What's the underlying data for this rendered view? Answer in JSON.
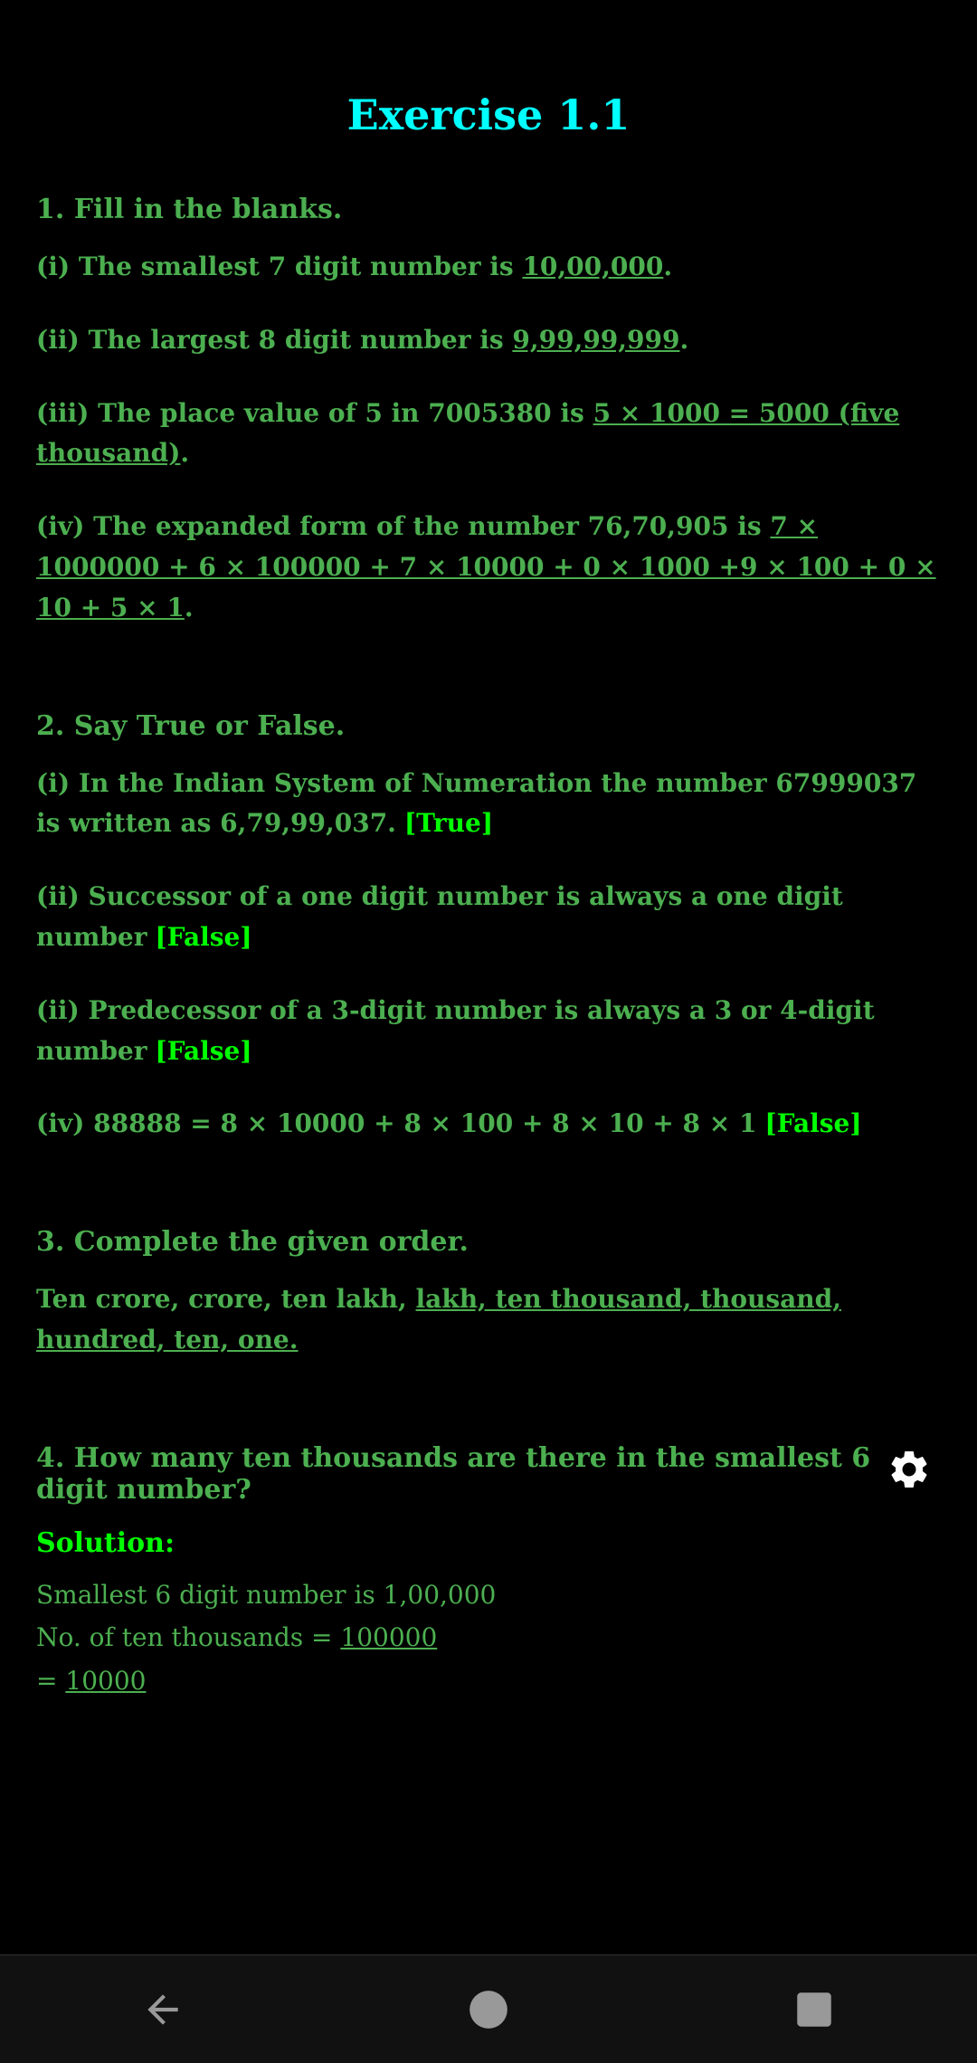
{
  "page": {
    "title": "Exercise 1.1"
  },
  "section1": {
    "header": "1. Fill in the blanks.",
    "q1": {
      "text_before": "(i) The smallest 7 digit number is ",
      "answer": "10,00,000",
      "text_after": "."
    },
    "q2": {
      "text_before": "(ii) The largest 8 digit number is ",
      "answer": "9,99,99,999",
      "text_after": "."
    },
    "q3": {
      "text_before": "(iii)  The place value of 5 in 7005380 is ",
      "answer": "5 × 1000 = 5000  (five thousand)",
      "text_after": "."
    },
    "q4": {
      "text_before": "(iv) The expanded form of the number 76,70,905 is ",
      "answer": "7 × 1000000 + 6 × 100000 + 7 × 10000 + 0 × 1000 +9 × 100 + 0 × 10 + 5 × 1",
      "text_after": "."
    }
  },
  "section2": {
    "header": "2. Say True or False.",
    "q1": {
      "text": "(i)  In the Indian System of Numeration the number 67999037 is written as 6,79,99,037.",
      "answer": "[True]"
    },
    "q2": {
      "text": "(ii)  Successor of a one digit number is always a one digit number",
      "answer": "[False]"
    },
    "q3": {
      "text": "(ii)  Predecessor of a 3-digit number is always a 3 or 4-digit number",
      "answer": "[False]"
    },
    "q4": {
      "text": "(iv) 88888 = 8 × 10000 + 8 × 100 + 8 × 10 + 8 × 1",
      "answer": "[False]"
    }
  },
  "section3": {
    "header": "3. Complete the given order.",
    "text_before": "Ten crore, crore, ten lakh, ",
    "answer": "lakh, ten thousand, thousand, hundred, ten, one.",
    "text_after": ""
  },
  "section4": {
    "header": "4. How many ten thousands are there in the smallest 6 digit number?",
    "solution_label": "Solution:",
    "line1": "Smallest 6 digit number is 1,00,000",
    "line2_before": "No. of ten thousands = ",
    "line2_answer": "100000",
    "line3_before": "                              = ",
    "line3_answer": "10000"
  },
  "navbar": {
    "back_label": "back",
    "home_label": "home",
    "recent_label": "recent"
  }
}
